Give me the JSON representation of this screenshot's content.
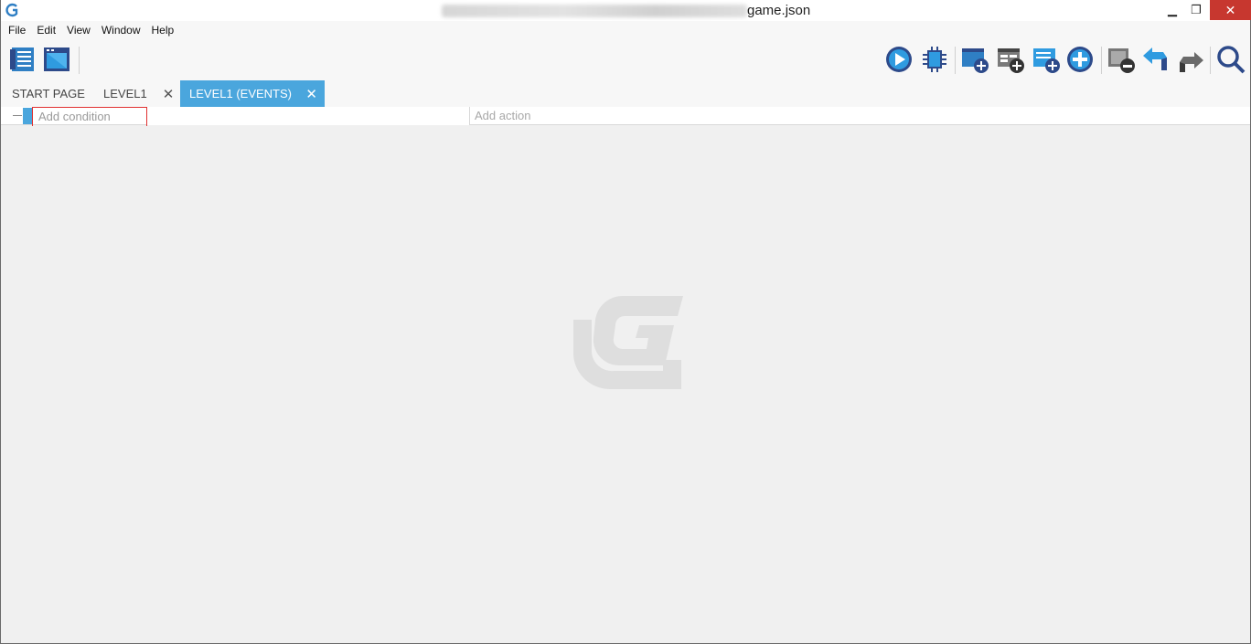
{
  "window": {
    "title": "game.json",
    "controls": {
      "minimize": "▁",
      "restore": "❐",
      "close": "✕"
    }
  },
  "menu": [
    "File",
    "Edit",
    "View",
    "Window",
    "Help"
  ],
  "toolbar": {
    "left_buttons": [
      "project-manager-icon",
      "scene-editor-icon"
    ],
    "right_buttons": [
      "preview-icon",
      "debug-icon",
      "add-scene-icon",
      "add-external-events-icon",
      "add-external-layout-icon",
      "add-object-icon",
      "remove-icon",
      "undo-icon",
      "redo-icon",
      "search-icon"
    ]
  },
  "tabs": {
    "start_page": "START PAGE",
    "level1": "LEVEL1",
    "level1_events": "LEVEL1 (EVENTS)",
    "close_glyph": "✕"
  },
  "events": {
    "add_condition": "Add condition",
    "add_action": "Add action"
  },
  "colors": {
    "accent": "#4aa6dd",
    "close_button": "#c7372f",
    "highlight_border": "#e03030",
    "icon_blue": "#2f7fc4",
    "icon_dark": "#2d4a8a"
  }
}
